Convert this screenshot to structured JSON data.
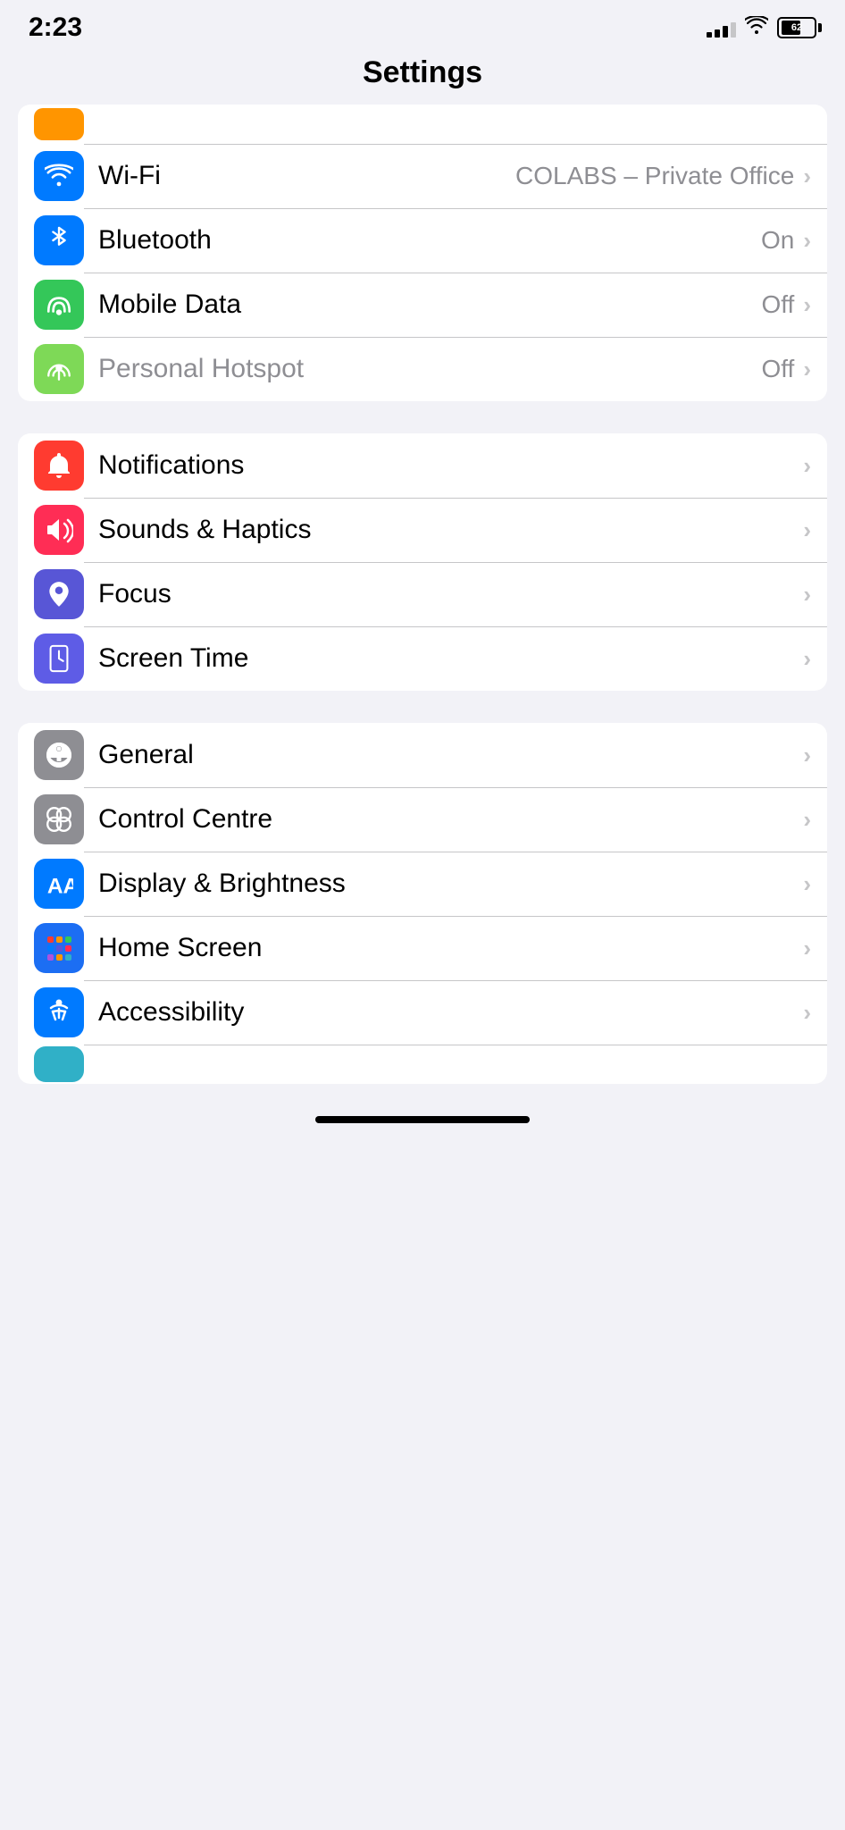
{
  "statusBar": {
    "time": "2:23",
    "battery": "62",
    "signal": [
      3,
      5,
      7,
      9,
      11
    ],
    "wifiIcon": "wifi"
  },
  "pageTitle": "Settings",
  "groups": [
    {
      "id": "connectivity",
      "items": [
        {
          "id": "airplane",
          "label": "",
          "value": "",
          "iconBg": "bg-orange",
          "icon": "airplane",
          "partial": true
        },
        {
          "id": "wifi",
          "label": "Wi-Fi",
          "value": "COLABS – Private Office",
          "iconBg": "bg-blue",
          "icon": "wifi"
        },
        {
          "id": "bluetooth",
          "label": "Bluetooth",
          "value": "On",
          "iconBg": "bg-blue",
          "icon": "bluetooth"
        },
        {
          "id": "mobile-data",
          "label": "Mobile Data",
          "value": "Off",
          "iconBg": "bg-green",
          "icon": "antenna"
        },
        {
          "id": "personal-hotspot",
          "label": "Personal Hotspot",
          "value": "Off",
          "iconBg": "bg-light-green-hotspot",
          "icon": "hotspot",
          "dimmed": true
        }
      ]
    },
    {
      "id": "notifications-group",
      "items": [
        {
          "id": "notifications",
          "label": "Notifications",
          "value": "",
          "iconBg": "bg-red",
          "icon": "bell"
        },
        {
          "id": "sounds-haptics",
          "label": "Sounds & Haptics",
          "value": "",
          "iconBg": "bg-pink",
          "icon": "speaker"
        },
        {
          "id": "focus",
          "label": "Focus",
          "value": "",
          "iconBg": "bg-purple-focus",
          "icon": "moon"
        },
        {
          "id": "screen-time",
          "label": "Screen Time",
          "value": "",
          "iconBg": "bg-indigo",
          "icon": "hourglass"
        }
      ]
    },
    {
      "id": "general-group",
      "items": [
        {
          "id": "general",
          "label": "General",
          "value": "",
          "iconBg": "bg-gray-gear",
          "icon": "gear"
        },
        {
          "id": "control-centre",
          "label": "Control Centre",
          "value": "",
          "iconBg": "bg-gray-control",
          "icon": "sliders"
        },
        {
          "id": "display-brightness",
          "label": "Display & Brightness",
          "value": "",
          "iconBg": "bg-blue",
          "icon": "display"
        },
        {
          "id": "home-screen",
          "label": "Home Screen",
          "value": "",
          "iconBg": "bg-blue-home",
          "icon": "grid"
        },
        {
          "id": "accessibility",
          "label": "Accessibility",
          "value": "",
          "iconBg": "bg-blue",
          "icon": "accessibility"
        },
        {
          "id": "partial-bottom",
          "label": "",
          "value": "",
          "iconBg": "bg-teal",
          "icon": "partial",
          "partial": true
        }
      ]
    }
  ]
}
